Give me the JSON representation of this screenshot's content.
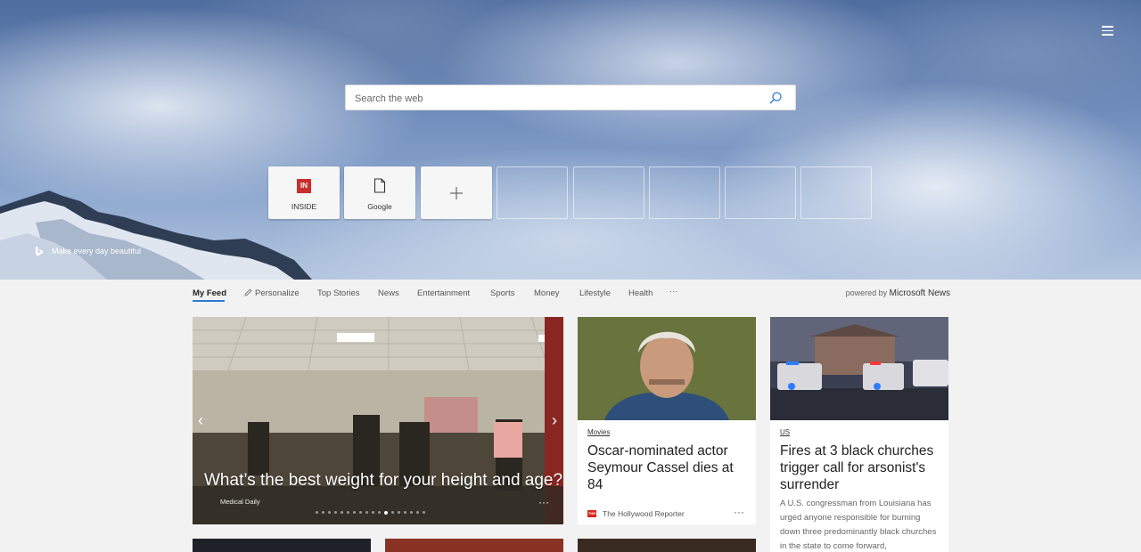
{
  "search": {
    "placeholder": "Search the web"
  },
  "quick_links": [
    {
      "label": "INSIDE",
      "icon": "inside-logo-icon",
      "badge": "IN"
    },
    {
      "label": "Google",
      "icon": "document-icon"
    },
    {
      "label": "",
      "icon": "plus-icon"
    }
  ],
  "bing_credit": "Make every day beautiful",
  "nav": {
    "items": [
      "My Feed",
      "Personalize",
      "Top Stories",
      "News",
      "Entertainment",
      "Sports",
      "Money",
      "Lifestyle",
      "Health"
    ],
    "more": "···",
    "powered_prefix": "powered by",
    "powered_brand": "Microsoft News"
  },
  "hero_story": {
    "title": "What’s the best weight for your height and age?",
    "source": "Medical Daily",
    "prev": "‹",
    "next": "›",
    "more": "···",
    "dots_total": 18,
    "dots_active_index": 11
  },
  "cards": [
    {
      "category": "Movies",
      "title": "Oscar-nominated actor Seymour Cassel dies at 84",
      "source": "The Hollywood Reporter",
      "source_logo_text": "THR",
      "more": "···"
    },
    {
      "category": "US",
      "title": "Fires at 3 black churches trigger call for arsonist's surrender",
      "snippet": "A U.S. congressman from Louisiana has urged anyone responsible for burning down three predominantly black churches in the state to come forward,"
    }
  ],
  "colors": {
    "accent": "#2b7bd1",
    "inside_red": "#c9302c",
    "thr_red": "#d9261c"
  }
}
